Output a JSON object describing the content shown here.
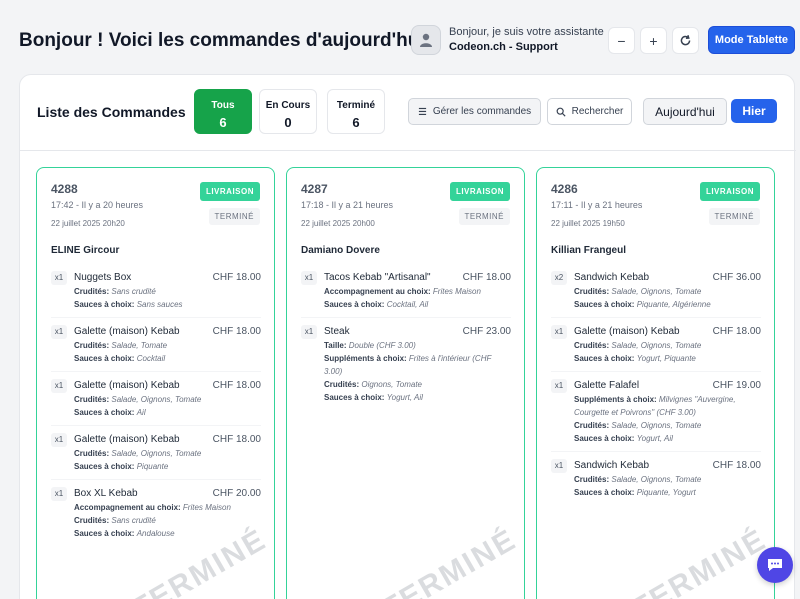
{
  "header": {
    "title": "Bonjour ! Voici les commandes d'aujourd'hui",
    "assistant_greeting": "Bonjour, je suis votre assistante",
    "assistant_name": "Codeon.ch - Support",
    "mode_button": "Mode Tablette",
    "icons": [
      "minus-icon",
      "plus-icon",
      "refresh-icon"
    ]
  },
  "list": {
    "title": "Liste des Commandes",
    "stats": [
      {
        "label": "Tous",
        "value": "6"
      },
      {
        "label": "En Cours",
        "value": "0"
      },
      {
        "label": "Terminé",
        "value": "6"
      }
    ],
    "manage_button": "Gérer les commandes",
    "search_button": "Rechercher",
    "today_button": "Aujourd'hui",
    "yesterday_button": "Hier"
  },
  "orders": [
    {
      "number": "4288",
      "time": "17:42 - Il y a 20 heures",
      "date": "22 juillet 2025 20h20",
      "type_badge": "LIVRAISON",
      "status_badge": "TERMINÉ",
      "watermark": "TERMINÉ",
      "customer": "ELINE Gircour",
      "items": [
        {
          "qty": "x1",
          "name": "Nuggets Box",
          "price": "CHF 18.00",
          "options": [
            {
              "label": "Crudités:",
              "value": "Sans crudité"
            },
            {
              "label": "Sauces à choix:",
              "value": "Sans sauces"
            }
          ]
        },
        {
          "qty": "x1",
          "name": "Galette (maison) Kebab",
          "price": "CHF 18.00",
          "options": [
            {
              "label": "Crudités:",
              "value": "Salade, Tomate"
            },
            {
              "label": "Sauces à choix:",
              "value": "Cocktail"
            }
          ]
        },
        {
          "qty": "x1",
          "name": "Galette (maison) Kebab",
          "price": "CHF 18.00",
          "options": [
            {
              "label": "Crudités:",
              "value": "Salade, Oignons, Tomate"
            },
            {
              "label": "Sauces à choix:",
              "value": "Ail"
            }
          ]
        },
        {
          "qty": "x1",
          "name": "Galette (maison) Kebab",
          "price": "CHF 18.00",
          "options": [
            {
              "label": "Crudités:",
              "value": "Salade, Oignons, Tomate"
            },
            {
              "label": "Sauces à choix:",
              "value": "Piquante"
            }
          ]
        },
        {
          "qty": "x1",
          "name": "Box XL Kebab",
          "price": "CHF 20.00",
          "options": [
            {
              "label": "Accompagnement au choix:",
              "value": "Frites Maison"
            },
            {
              "label": "Crudités:",
              "value": "Sans crudité"
            },
            {
              "label": "Sauces à choix:",
              "value": "Andalouse"
            }
          ]
        }
      ]
    },
    {
      "number": "4287",
      "time": "17:18 - Il y a 21 heures",
      "date": "22 juillet 2025 20h00",
      "type_badge": "LIVRAISON",
      "status_badge": "TERMINÉ",
      "watermark": "TERMINÉ",
      "customer": "Damiano Dovere",
      "items": [
        {
          "qty": "x1",
          "name": "Tacos Kebab \"Artisanal\"",
          "price": "CHF 18.00",
          "options": [
            {
              "label": "Accompagnement au choix:",
              "value": "Frites Maison"
            },
            {
              "label": "Sauces à choix:",
              "value": "Cocktail, Ail"
            }
          ]
        },
        {
          "qty": "x1",
          "name": "Steak",
          "price": "CHF 23.00",
          "options": [
            {
              "label": "Taille:",
              "value": "Double (CHF 3.00)"
            },
            {
              "label": "Suppléments à choix:",
              "value": "Frites à l'intérieur (CHF 3.00)"
            },
            {
              "label": "Crudités:",
              "value": "Oignons, Tomate"
            },
            {
              "label": "Sauces à choix:",
              "value": "Yogurt, Ail"
            }
          ]
        }
      ]
    },
    {
      "number": "4286",
      "time": "17:11 - Il y a 21 heures",
      "date": "22 juillet 2025 19h50",
      "type_badge": "LIVRAISON",
      "status_badge": "TERMINÉ",
      "watermark": "TERMINÉ",
      "customer": "Killian Frangeul",
      "items": [
        {
          "qty": "x2",
          "name": "Sandwich Kebab",
          "price": "CHF 36.00",
          "options": [
            {
              "label": "Crudités:",
              "value": "Salade, Oignons, Tomate"
            },
            {
              "label": "Sauces à choix:",
              "value": "Piquante, Algérienne"
            }
          ]
        },
        {
          "qty": "x1",
          "name": "Galette (maison) Kebab",
          "price": "CHF 18.00",
          "options": [
            {
              "label": "Crudités:",
              "value": "Salade, Oignons, Tomate"
            },
            {
              "label": "Sauces à choix:",
              "value": "Yogurt, Piquante"
            }
          ]
        },
        {
          "qty": "x1",
          "name": "Galette Falafel",
          "price": "CHF 19.00",
          "options": [
            {
              "label": "Suppléments à choix:",
              "value": "Milvignes \"Auvergine, Courgette et Poivrons\" (CHF 3.00)"
            },
            {
              "label": "Crudités:",
              "value": "Salade, Oignons, Tomate"
            },
            {
              "label": "Sauces à choix:",
              "value": "Yogurt, Ail"
            }
          ]
        },
        {
          "qty": "x1",
          "name": "Sandwich Kebab",
          "price": "CHF 18.00",
          "options": [
            {
              "label": "Crudités:",
              "value": "Salade, Oignons, Tomate"
            },
            {
              "label": "Sauces à choix:",
              "value": "Piquante, Yogurt"
            }
          ]
        }
      ]
    }
  ]
}
